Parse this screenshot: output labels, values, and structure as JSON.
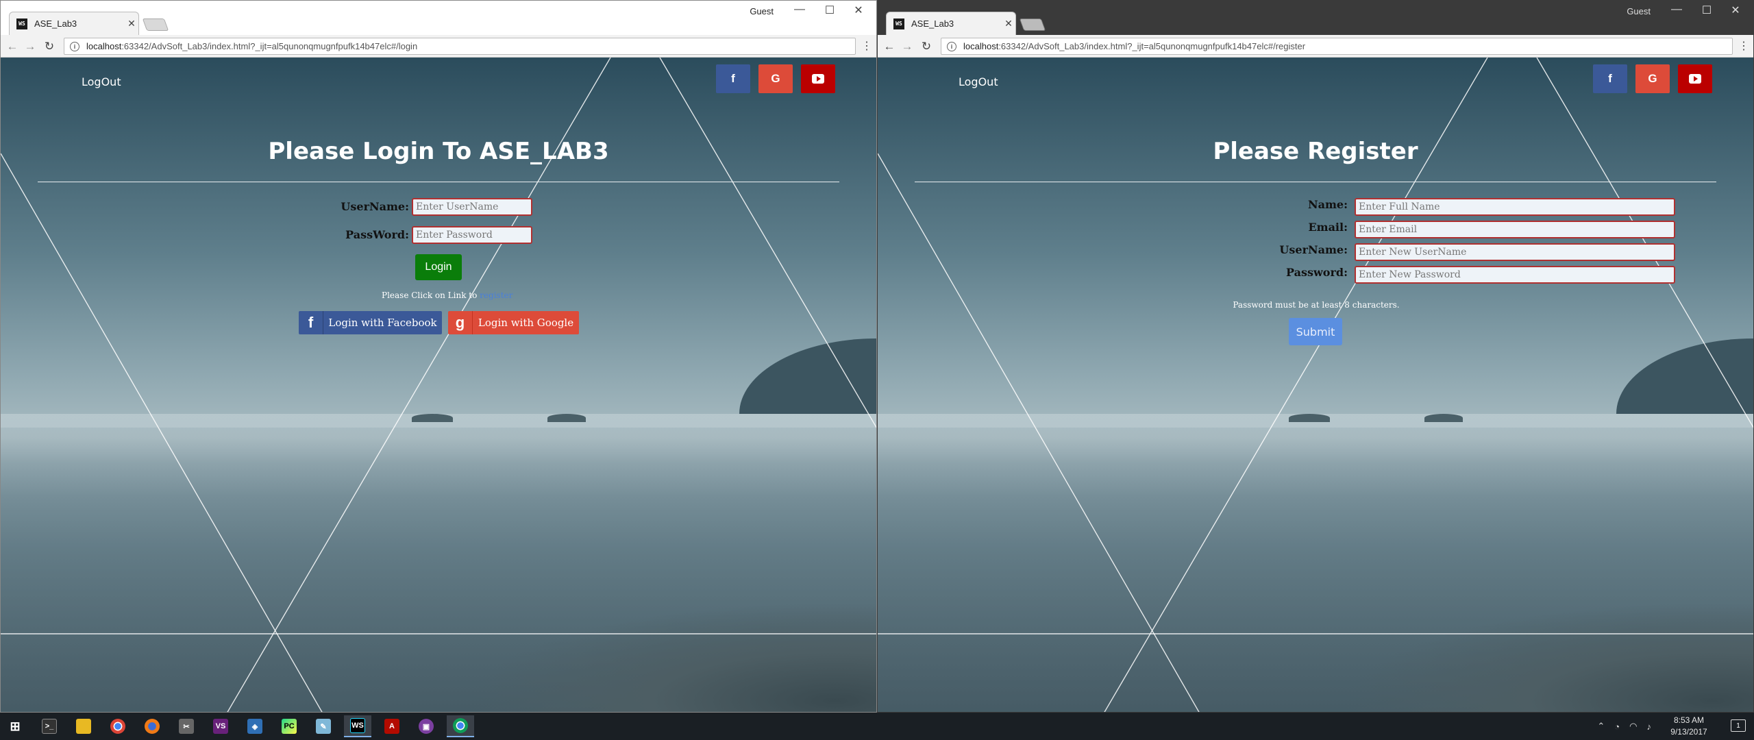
{
  "left_window": {
    "tab_title": "ASE_Lab3",
    "guest_label": "Guest",
    "url_host": "localhost",
    "url_rest": ":63342/AdvSoft_Lab3/index.html?_ijt=al5qunonqmugnfpufk14b47elc#/login",
    "nav": {
      "logout": "LogOut"
    },
    "page": {
      "title": "Please Login To ASE_LAB3",
      "username_label": "UserName:",
      "username_placeholder": "Enter UserName",
      "password_label": "PassWord:",
      "password_placeholder": "Enter Password",
      "login_button": "Login",
      "note_text": "Please Click on Link to",
      "note_link": "register",
      "facebook_button": "Login with Facebook",
      "google_button": "Login with Google"
    }
  },
  "right_window": {
    "tab_title": "ASE_Lab3",
    "guest_label": "Guest",
    "url_host": "localhost",
    "url_rest": ":63342/AdvSoft_Lab3/index.html?_ijt=al5qunonqmugnfpufk14b47elc#/register",
    "nav": {
      "logout": "LogOut"
    },
    "page": {
      "title": "Please Register",
      "name_label": "Name:",
      "name_placeholder": "Enter Full Name",
      "email_label": "Email:",
      "email_placeholder": "Enter Email",
      "username_label": "UserName:",
      "username_placeholder": "Enter New UserName",
      "password_label": "Password:",
      "password_placeholder": "Enter New Password",
      "password_hint": "Password must be at least 8 characters.",
      "submit_button": "Submit"
    }
  },
  "social_icons": {
    "facebook": "f",
    "google": "G",
    "youtube": "youtube-icon"
  },
  "taskbar": {
    "time": "8:53 AM",
    "date": "9/13/2017",
    "apps": [
      "start-icon",
      "terminal-icon",
      "file-explorer-icon",
      "chrome-icon",
      "firefox-icon",
      "tools-icon",
      "visual-studio-icon",
      "network-icon",
      "pycharm-icon",
      "notepad-icon",
      "webstorm-icon",
      "acrobat-icon",
      "media-icon",
      "chrome-active-icon"
    ]
  },
  "colors": {
    "facebook": "#3b5998",
    "google": "#dd4b39",
    "youtube": "#bb0000",
    "login_green": "#0a7d0a",
    "submit_blue": "#5b8fe0",
    "input_border": "#b03030"
  }
}
